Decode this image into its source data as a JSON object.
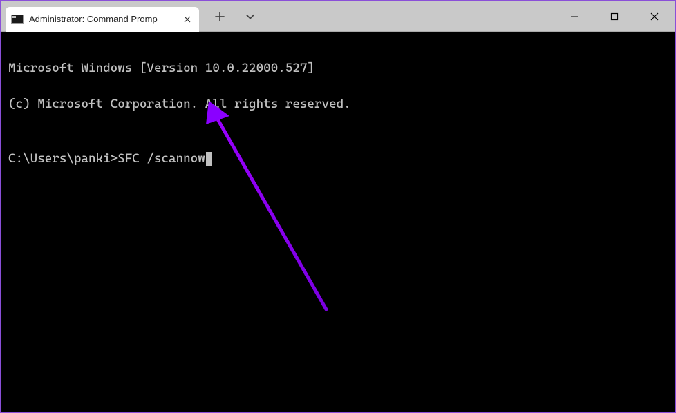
{
  "window": {
    "tab_title": "Administrator: Command Promp",
    "tab_icon_name": "terminal-app-icon",
    "new_tab_icon": "plus-icon",
    "dropdown_icon": "chevron-down-icon",
    "minimize_icon": "minimize-icon",
    "maximize_icon": "maximize-icon",
    "close_icon": "close-icon"
  },
  "terminal": {
    "line1": "Microsoft Windows [Version 10.0.22000.527]",
    "line2": "(c) Microsoft Corporation. All rights reserved.",
    "blank": "",
    "prompt": "C:\\Users\\panki>",
    "command": "SFC /scannow"
  },
  "annotation": {
    "color": "#8a00ff",
    "description": "arrow-pointing-to-command"
  }
}
